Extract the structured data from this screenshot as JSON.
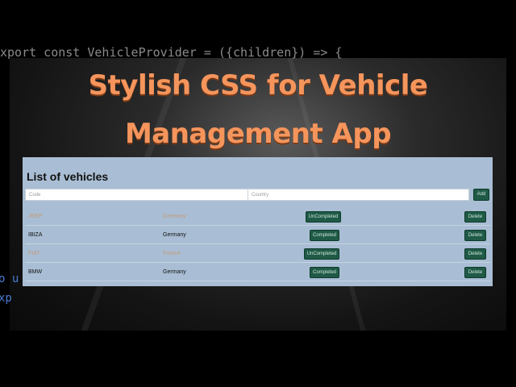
{
  "background": {
    "code_line": "xport const VehicleProvider = ({children}) => {",
    "side_fragments": [
      "o u",
      "xp"
    ]
  },
  "headline": {
    "line1": "Stylish CSS for Vehicle",
    "line2": "Management App",
    "color": "#f5955c"
  },
  "app": {
    "title": "List of vehicles",
    "code_placeholder": "Code",
    "country_placeholder": "Country",
    "add_label": "Add",
    "rows": [
      {
        "code": "JEEP",
        "country": "Germany",
        "status": "UnCompleted",
        "delete": "Delete",
        "faded": true
      },
      {
        "code": "IBIZA",
        "country": "Germany",
        "status": "Completed",
        "delete": "Delete",
        "faded": false
      },
      {
        "code": "FIAT",
        "country": "France",
        "status": "UnCompleted",
        "delete": "Delete",
        "faded": true
      },
      {
        "code": "BMW",
        "country": "Germany",
        "status": "Completed",
        "delete": "Delete",
        "faded": false
      }
    ],
    "colors": {
      "panel": "#a9bed4",
      "button": "#1f5a46"
    }
  }
}
